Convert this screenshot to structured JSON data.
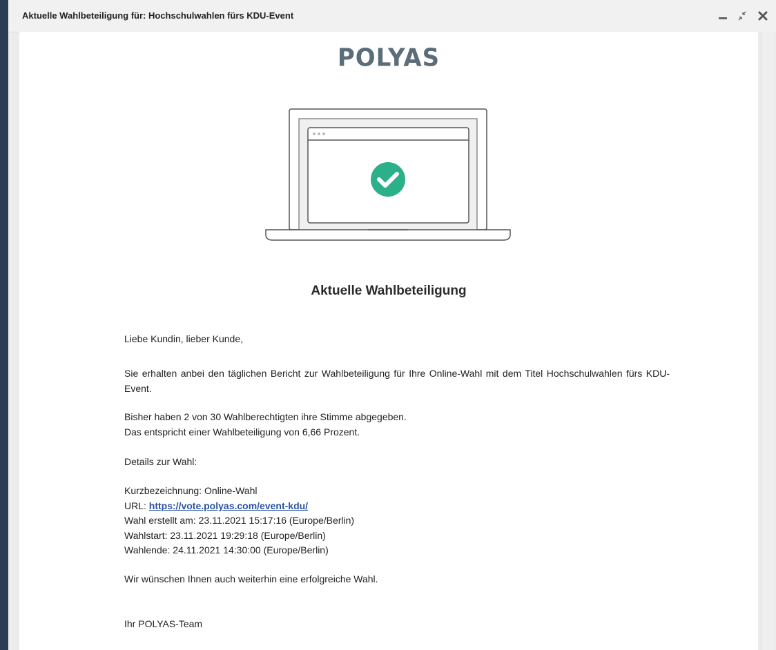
{
  "window": {
    "title": "Aktuelle Wahlbeteiligung für: Hochschulwahlen fürs KDU-Event",
    "controls": {
      "minimize": "minimize-icon",
      "shrink": "shrink-icon",
      "close": "close-icon"
    }
  },
  "email": {
    "logo": "POLYAS",
    "heading": "Aktuelle Wahlbeteiligung",
    "greeting": "Liebe Kundin, lieber Kunde,",
    "intro": "Sie erhalten anbei den täglichen Bericht zur Wahlbeteiligung für Ihre Online-Wahl mit dem Titel Hochschulwahlen fürs KDU-Event.",
    "stats_line1": "Bisher haben 2 von 30 Wahlberechtigten ihre Stimme abgegeben.",
    "stats_line2": "Das entspricht einer Wahlbeteiligung von 6,66 Prozent.",
    "details_heading": "Details zur Wahl:",
    "details": {
      "short_name": "Kurzbezeichnung: Online-Wahl",
      "url_label": "URL: ",
      "url": "https://vote.polyas.com/event-kdu/",
      "created": "Wahl erstellt am: 23.11.2021 15:17:16 (Europe/Berlin)",
      "start": "Wahlstart: 23.11.2021 19:29:18 (Europe/Berlin)",
      "end": "Wahlende: 24.11.2021 14:30:00 (Europe/Berlin)"
    },
    "closing": "Wir wünschen Ihnen auch weiterhin eine erfolgreiche Wahl.",
    "signature": "Ihr POLYAS-Team"
  },
  "colors": {
    "background": "#2b3d55",
    "logo": "#5b6d78",
    "check": "#2bb08a",
    "link": "#2a54a6"
  },
  "illustration": {
    "icon": "laptop-with-checkmark-icon"
  }
}
